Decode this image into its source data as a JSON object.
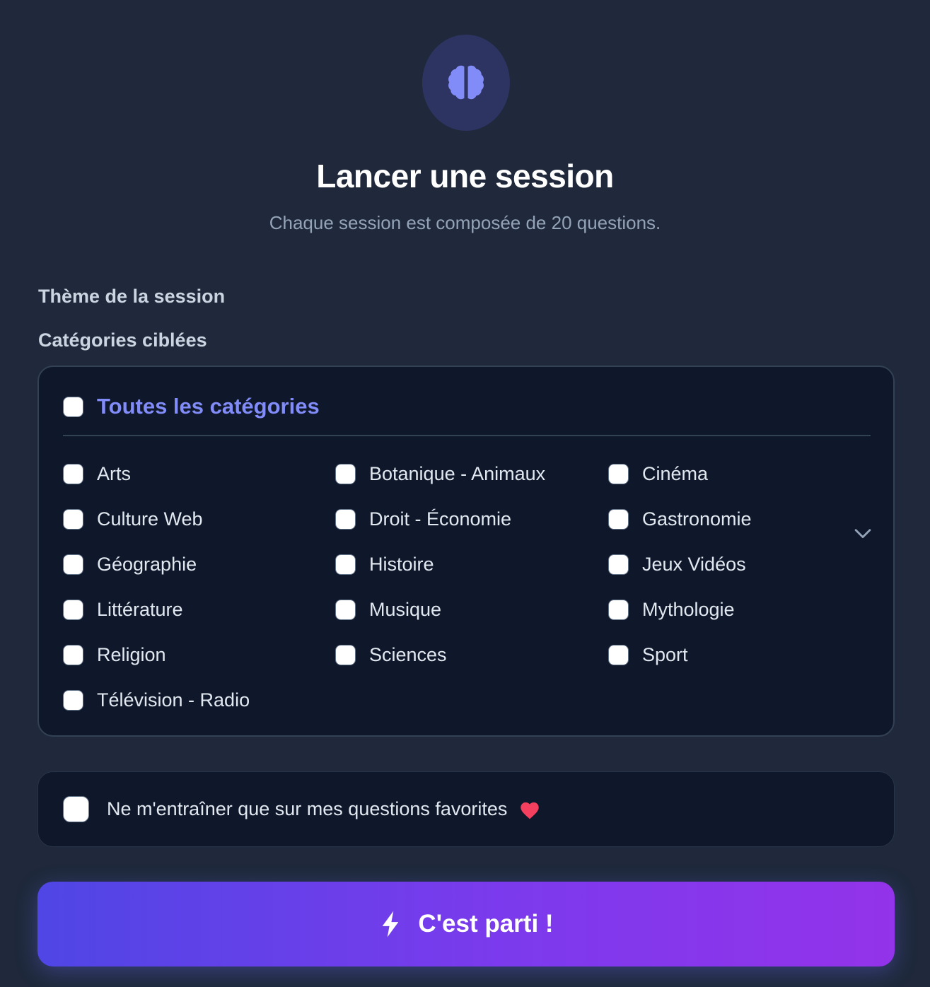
{
  "header": {
    "icon": "brain-icon",
    "title": "Lancer une session",
    "subtitle": "Chaque session est composée de 20 questions."
  },
  "form": {
    "theme_label": "Thème de la session",
    "categories_label": "Catégories ciblées",
    "all_categories_label": "Toutes les catégories",
    "categories": [
      "Arts",
      "Botanique - Animaux",
      "Cinéma",
      "Culture Web",
      "Droit - Économie",
      "Gastronomie",
      "Géographie",
      "Histoire",
      "Jeux Vidéos",
      "Littérature",
      "Musique",
      "Mythologie",
      "Religion",
      "Sciences",
      "Sport",
      "Télévision - Radio"
    ],
    "favorites_label": "Ne m'entraîner que sur mes questions favorites",
    "favorites_icon": "heart-icon",
    "submit_label": "C'est parti !",
    "submit_icon": "bolt-icon"
  },
  "colors": {
    "background": "#1f293b",
    "panel": "#0f172a",
    "accent": "#818cf8",
    "heart": "#f43f5e",
    "button_gradient_start": "#4f46e5",
    "button_gradient_end": "#9333ea"
  }
}
